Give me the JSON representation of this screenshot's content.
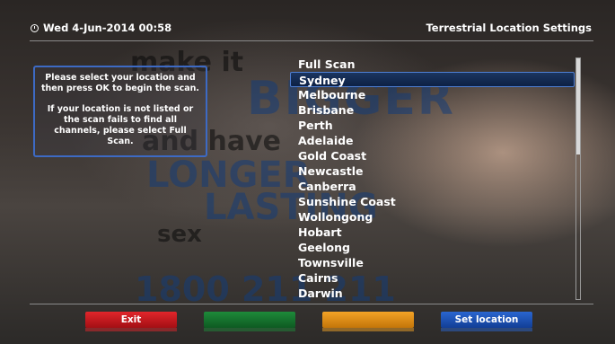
{
  "header": {
    "datetime": "Wed  4-Jun-2014 00:58",
    "title": "Terrestrial Location Settings"
  },
  "background_ad": {
    "lines": [
      "make it",
      "BIGGER",
      "and have",
      "LONGER",
      "LASTING",
      "sex",
      "1800 211 211"
    ]
  },
  "info": {
    "line1": "Please select your location and then press OK to begin the scan.",
    "line2": "If your location is not listed or the scan fails to find all channels, please select Full Scan."
  },
  "locations": {
    "selected_index": 1,
    "items": [
      "Full Scan",
      "Sydney",
      "Melbourne",
      "Brisbane",
      "Perth",
      "Adelaide",
      "Gold Coast",
      "Newcastle",
      "Canberra",
      "Sunshine Coast",
      "Wollongong",
      "Hobart",
      "Geelong",
      "Townsville",
      "Cairns",
      "Darwin"
    ]
  },
  "scrollbar": {
    "position_fraction": 0.0,
    "visible_fraction": 0.4
  },
  "buttons": {
    "red": "Exit",
    "green": "",
    "yellow": "",
    "blue": "Set location"
  },
  "colors": {
    "selection_border": "#4f7fd4",
    "red": "#e2262b",
    "green": "#1e8a3a",
    "yellow": "#f3a326",
    "blue": "#2a66d0"
  }
}
